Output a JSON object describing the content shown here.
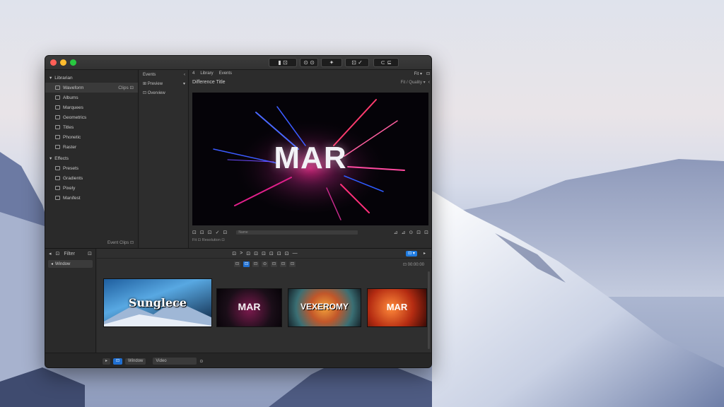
{
  "window": {
    "toolbar_buttons": [
      "▮ ⊡",
      "⊙ ⊙",
      "✦",
      "⊡ ✓",
      "⊂ ⊆"
    ]
  },
  "sidebar": {
    "section1": "Librarian",
    "items": [
      {
        "label": "Waveform",
        "right": "Clips ⊡"
      },
      {
        "label": "Albums"
      },
      {
        "label": "Marquees"
      },
      {
        "label": "Geometrics"
      },
      {
        "label": "Titles"
      },
      {
        "label": "Phonetic"
      },
      {
        "label": "Raster"
      }
    ],
    "section2": "Effects",
    "items2": [
      {
        "label": "Presets"
      },
      {
        "label": "Gradients"
      },
      {
        "label": "Pixely"
      },
      {
        "label": "Manifest"
      }
    ],
    "footer": "Event  Clips  ⊡"
  },
  "browser": {
    "header": "Events",
    "items": [
      "⊞ Preview",
      "⊡ Overview"
    ]
  },
  "viewer": {
    "top_left": [
      "4",
      "Library",
      "Events"
    ],
    "top_right": [
      "Fit ▾",
      "⊡"
    ],
    "title": "Difference Title",
    "title_right": "Fit / Quality ▾",
    "canvas_text": "MAR",
    "controls_left": [
      "⊡",
      "⊡",
      "⊡",
      "✓",
      "⊡"
    ],
    "scrub_label": "Name",
    "controls_right": [
      "⊿",
      "⊿",
      "⊙",
      "⊡",
      "⊡"
    ],
    "sub_label": "Fit  ⊡  Resolution  ⊡"
  },
  "timeline": {
    "left_header": [
      "◂",
      "⊡",
      "Filter",
      "⊡"
    ],
    "left_item": "Window",
    "tools": [
      "⊡",
      ">",
      "⊡",
      "⊡",
      "⊡",
      "⊡",
      "⊡",
      "⊡",
      "—"
    ],
    "tools_blue": "⊡ ▾",
    "tools_right": "▸",
    "bar_tools": [
      "⊡",
      "⊡",
      "⊡",
      "⊙",
      "⊡",
      "⊡",
      "⊡"
    ],
    "bar_right": "⊡ 00:00:00",
    "clips": [
      {
        "label": "Sunglece",
        "color": "#2f79b8"
      },
      {
        "label": "MAR",
        "color": "#1a0e18"
      },
      {
        "label": "VEXEROMY",
        "color": "#c2572a"
      },
      {
        "label": "MAR",
        "color": "#b52c12"
      }
    ]
  },
  "bottombar": {
    "buttons": [
      "▸",
      "⊡",
      "Window"
    ],
    "select": "Video",
    "right": "⊙"
  }
}
